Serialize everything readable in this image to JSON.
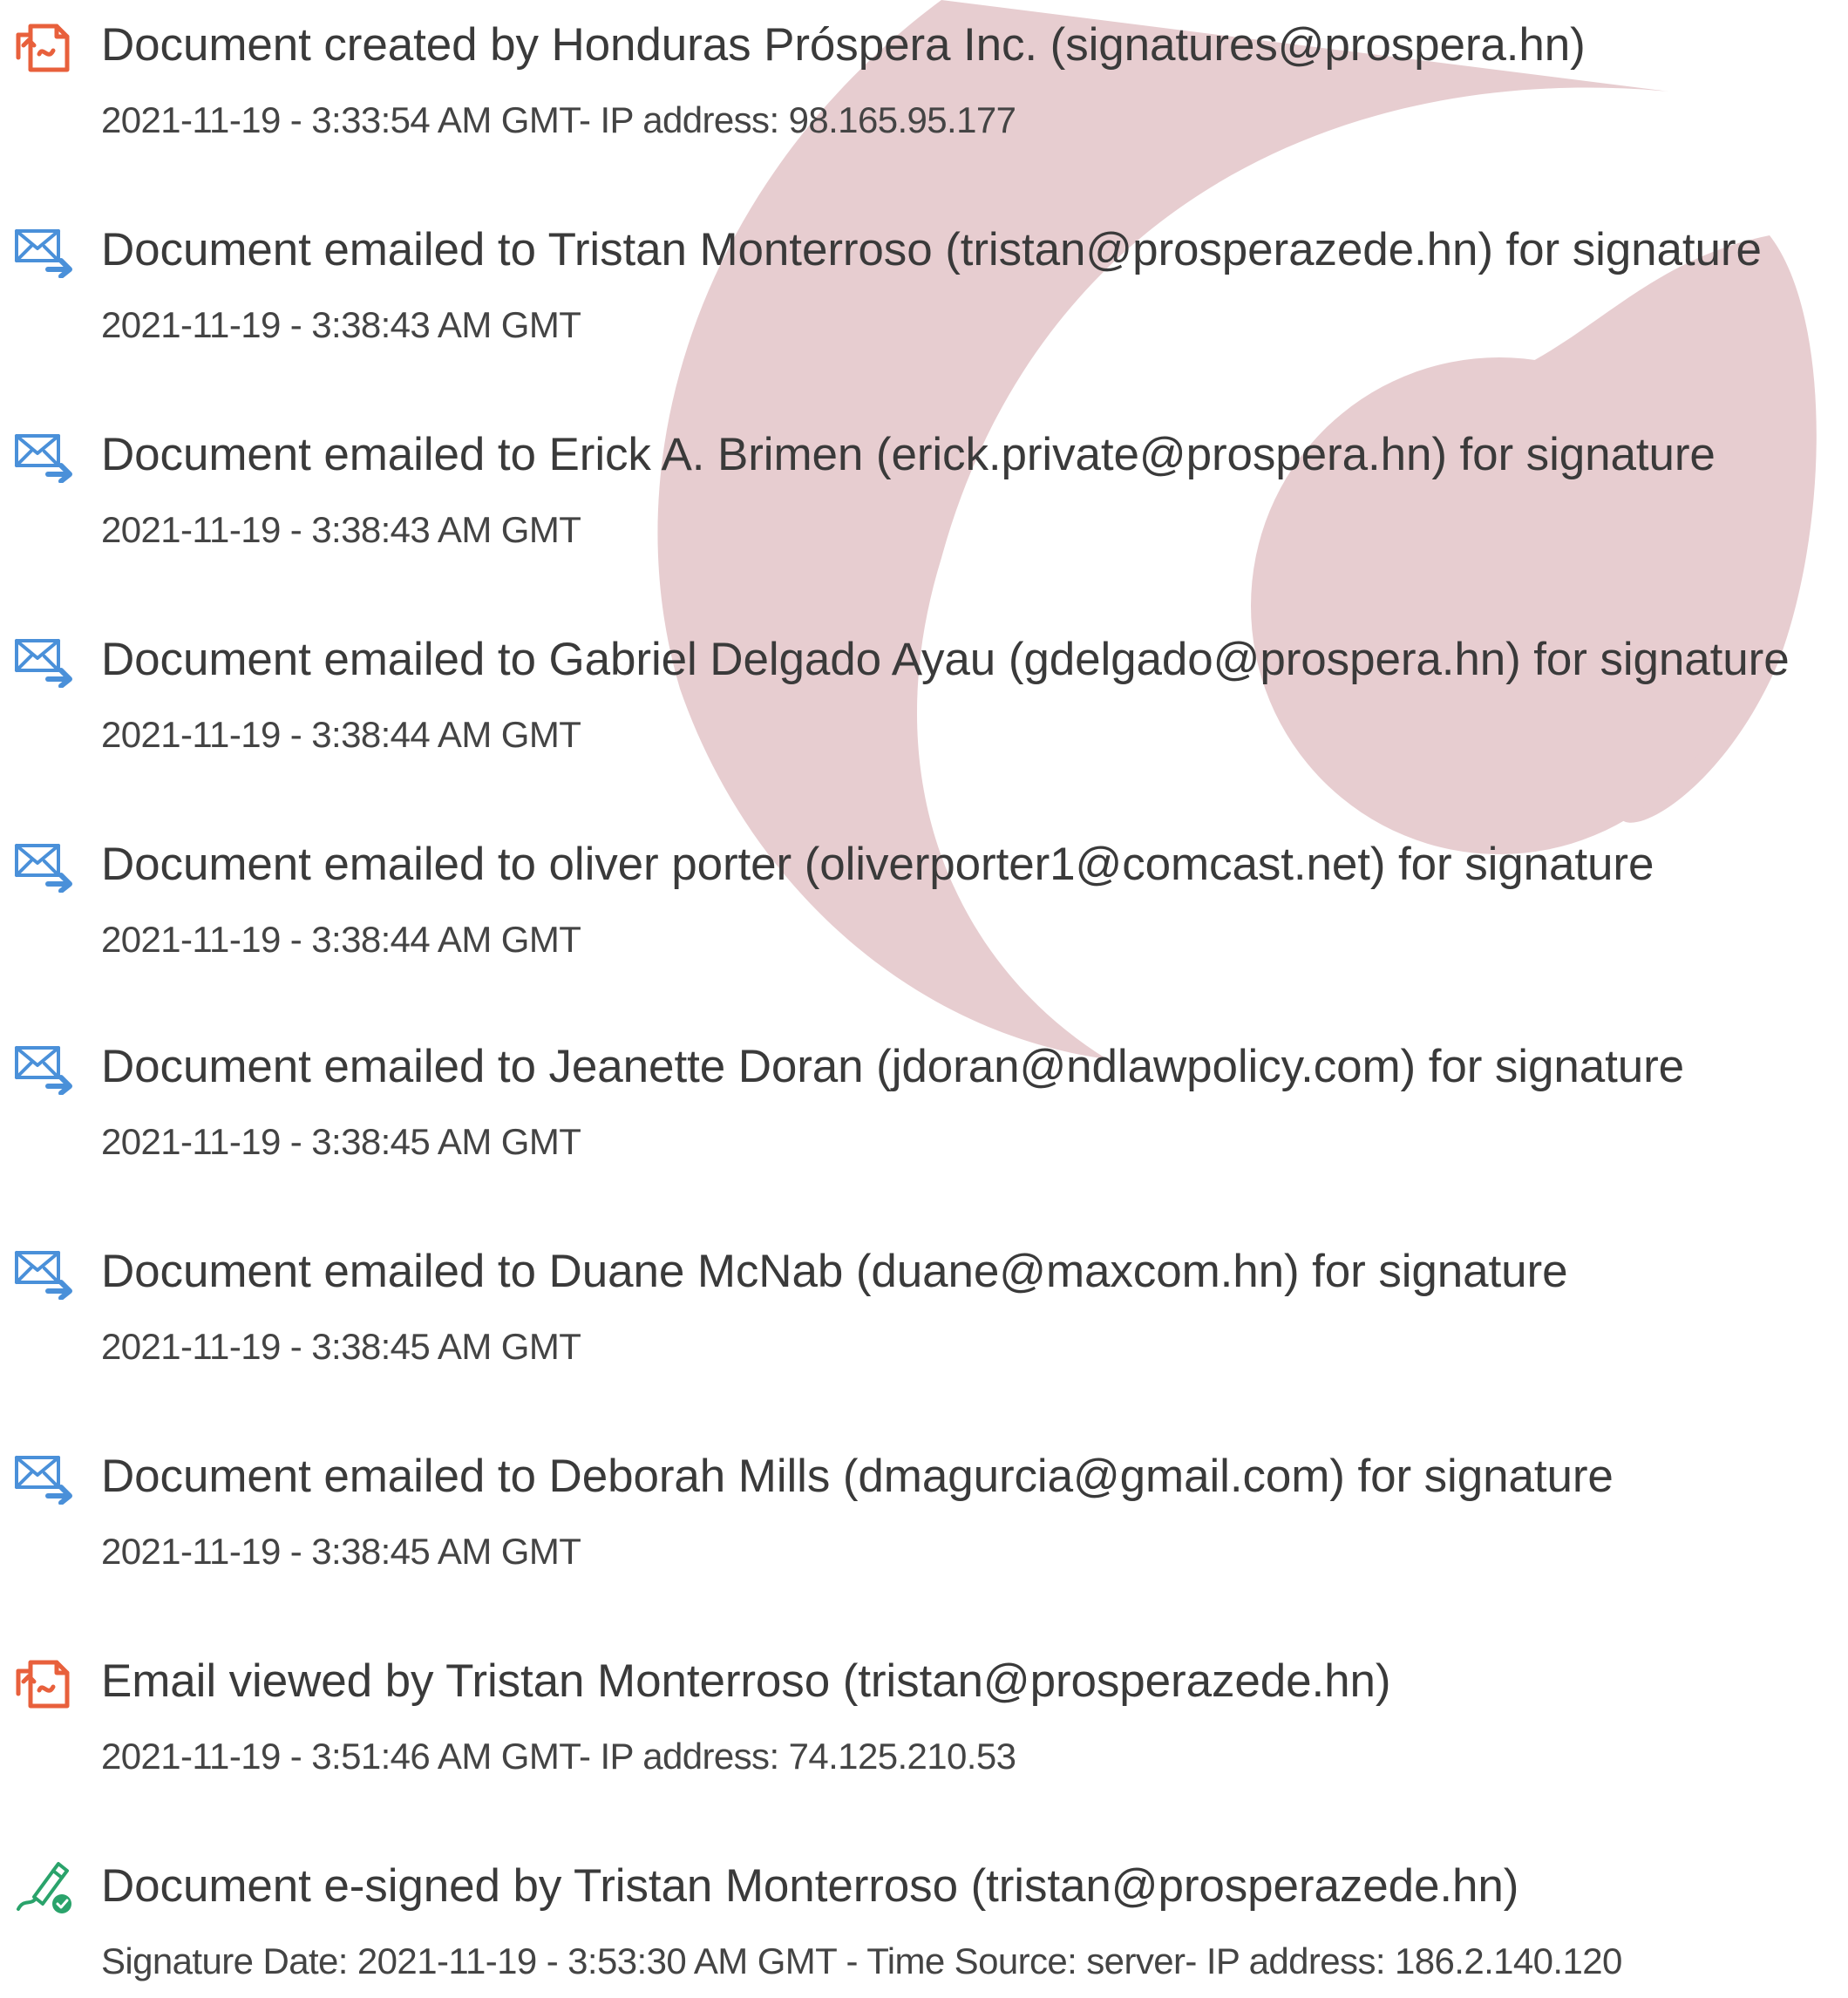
{
  "colors": {
    "watermark": "#e7cdd0",
    "created_icon": "#e8603c",
    "email_icon": "#4a90d9",
    "signed_icon": "#2aa36b",
    "text": "#3a3a3a"
  },
  "events": [
    {
      "icon": "document-created-icon",
      "title": "Document created by Honduras Próspera Inc. (signatures@prospera.hn)",
      "detail": "2021-11-19 - 3:33:54 AM GMT- IP address: 98.165.95.177"
    },
    {
      "icon": "email-sent-icon",
      "title": "Document emailed to Tristan Monterroso (tristan@prosperazede.hn) for signature",
      "detail": "2021-11-19 - 3:38:43 AM GMT"
    },
    {
      "icon": "email-sent-icon",
      "title": "Document emailed to Erick A. Brimen (erick.private@prospera.hn) for signature",
      "detail": "2021-11-19 - 3:38:43 AM GMT"
    },
    {
      "icon": "email-sent-icon",
      "title": "Document emailed to Gabriel Delgado Ayau (gdelgado@prospera.hn) for signature",
      "detail": "2021-11-19 - 3:38:44 AM GMT"
    },
    {
      "icon": "email-sent-icon",
      "title": "Document emailed to oliver porter (oliverporter1@comcast.net) for signature",
      "detail": "2021-11-19 - 3:38:44 AM GMT"
    },
    {
      "icon": "email-sent-icon",
      "title": "Document emailed to Jeanette Doran (jdoran@ndlawpolicy.com) for signature",
      "detail": "2021-11-19 - 3:38:45 AM GMT"
    },
    {
      "icon": "email-sent-icon",
      "title": "Document emailed to Duane McNab (duane@maxcom.hn) for signature",
      "detail": "2021-11-19 - 3:38:45 AM GMT"
    },
    {
      "icon": "email-sent-icon",
      "title": "Document emailed to Deborah Mills (dmagurcia@gmail.com) for signature",
      "detail": "2021-11-19 - 3:38:45 AM GMT"
    },
    {
      "icon": "document-created-icon",
      "title": "Email viewed by Tristan Monterroso (tristan@prosperazede.hn)",
      "detail": "2021-11-19 - 3:51:46 AM GMT- IP address: 74.125.210.53"
    },
    {
      "icon": "e-signed-icon",
      "title": "Document e-signed by Tristan Monterroso (tristan@prosperazede.hn)",
      "detail": "Signature Date: 2021-11-19 - 3:53:30 AM GMT - Time Source: server- IP address: 186.2.140.120"
    }
  ]
}
